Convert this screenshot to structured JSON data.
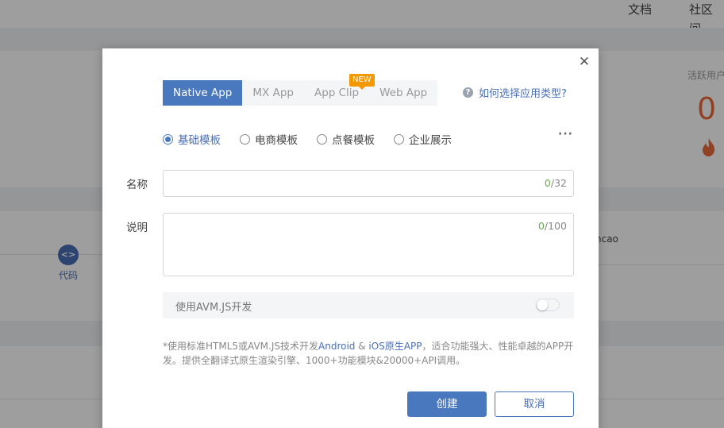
{
  "topnav": {
    "docs": "文档",
    "community": "社区问"
  },
  "stats": {
    "active_users_label": "活跃用户",
    "active_users_value": "0"
  },
  "sidebar": {
    "code_label": "代码"
  },
  "background_user_fragment": "ncao",
  "modal": {
    "app_types": [
      {
        "label": "Native App",
        "active": true
      },
      {
        "label": "MX App",
        "active": false
      },
      {
        "label": "App Clip",
        "active": false
      },
      {
        "label": "Web App",
        "active": false
      }
    ],
    "new_badge": "NEW",
    "help_link": "如何选择应用类型?",
    "templates": [
      {
        "label": "基础模板",
        "checked": true
      },
      {
        "label": "电商模板",
        "checked": false
      },
      {
        "label": "点餐模板",
        "checked": false
      },
      {
        "label": "企业展示",
        "checked": false
      }
    ],
    "more": "···",
    "name_label": "名称",
    "name_value": "",
    "name_count_current": "0",
    "name_count_max": "/32",
    "desc_label": "说明",
    "desc_value": "",
    "desc_count_current": "0",
    "desc_count_max": "/100",
    "avm_label": "使用AVM.JS开发",
    "avm_enabled": false,
    "note_part1": "*使用标准HTML5或AVM.JS技术开发",
    "note_android": "Android",
    "note_amp": " & ",
    "note_ios": "iOS原生APP",
    "note_part2": "，适合功能强大、性能卓越的APP开发。提供全翻译式原生渲染引擎、1000+功能模块&20000+API调用。",
    "create_label": "创建",
    "cancel_label": "取消"
  },
  "colors": {
    "primary": "#4a78be",
    "accent": "#ec6b3a",
    "badge": "#f39800"
  }
}
